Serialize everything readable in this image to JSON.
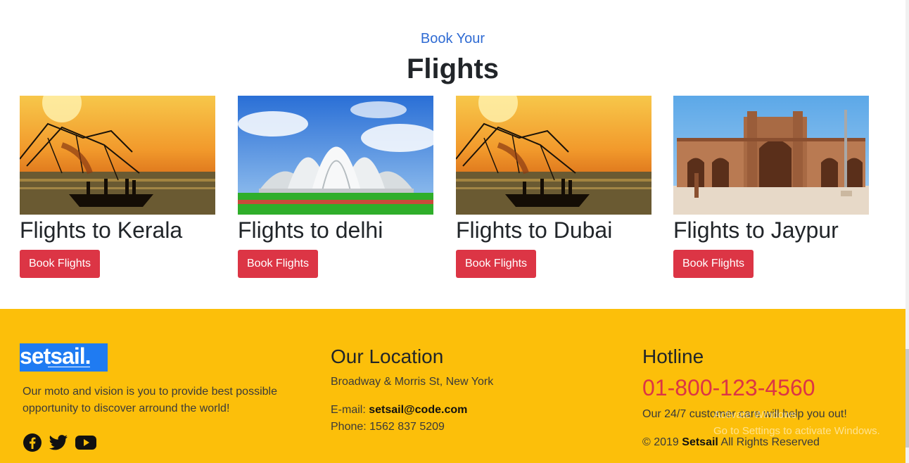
{
  "section": {
    "eyebrow": "Book Your",
    "heading": "Flights"
  },
  "cards": [
    {
      "title": "Flights to Kerala",
      "button": "Book Flights",
      "image": "kerala-fishing-nets-sunset"
    },
    {
      "title": "Flights to delhi",
      "button": "Book Flights",
      "image": "lotus-temple"
    },
    {
      "title": "Flights to Dubai",
      "button": "Book Flights",
      "image": "kerala-fishing-nets-sunset"
    },
    {
      "title": "Flights to Jaypur",
      "button": "Book Flights",
      "image": "stone-mosque-facade"
    }
  ],
  "footer": {
    "logo_text": "setsail.",
    "moto": "Our moto and vision is you to provide best possible opportunity to discover arround the world!",
    "social_icons": [
      "facebook-icon",
      "twitter-icon",
      "youtube-icon"
    ],
    "location": {
      "title": "Our Location",
      "address": "Broadway & Morris St, New York",
      "email_label": "E-mail:",
      "email": "setsail@code.com",
      "phone": "Phone: 1562 837 5209"
    },
    "hotline": {
      "title": "Hotline",
      "number": "01-800-123-4560",
      "care": "Our 24/7 customer care will help you out!",
      "copyright_prefix": "© 2019",
      "copyright_brand": "Setsail",
      "copyright_suffix": "All Rights Reserved"
    },
    "watermark": {
      "line1": "Activate Windows",
      "line2": "Go to Settings to activate Windows."
    }
  },
  "colors": {
    "accent_blue": "#2f6bd3",
    "button_red": "#dc3545",
    "footer_yellow": "#fcbf0a"
  }
}
